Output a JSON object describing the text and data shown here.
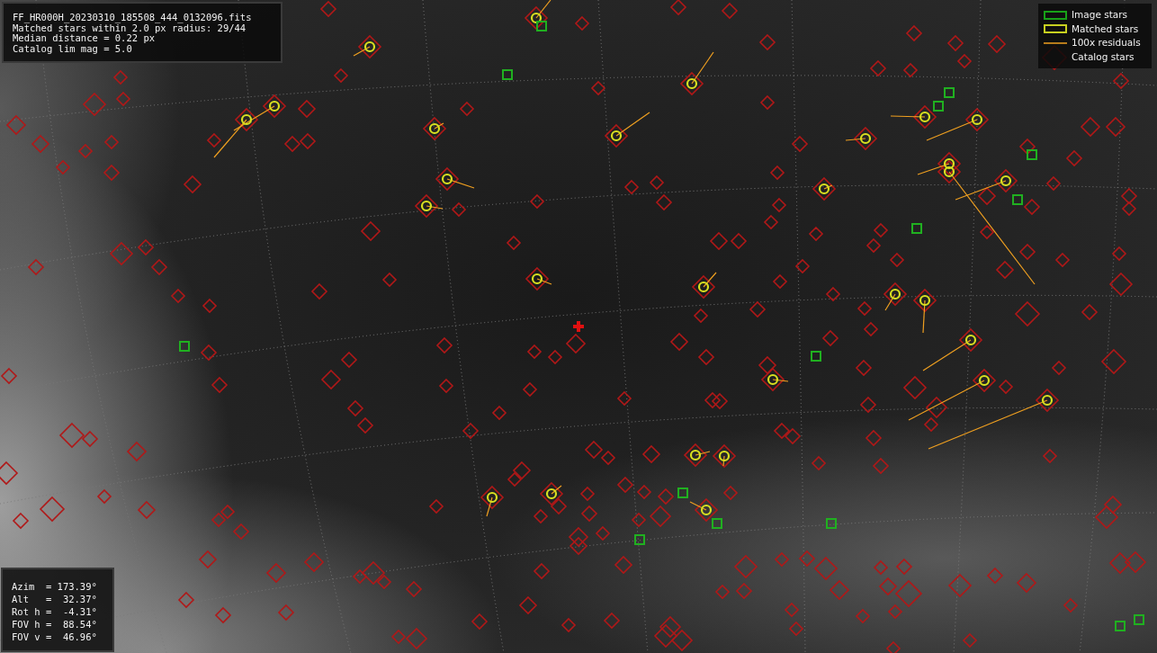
{
  "file_info": {
    "filename": "FF_HR000H_20230310_185508_444_0132096.fits",
    "lines": [
      "Matched stars within 2.0 px radius: 29/44",
      "Median distance = 0.22 px",
      "Catalog lim mag = 5.0"
    ]
  },
  "legend": [
    {
      "kind": "image",
      "label": "Image stars"
    },
    {
      "kind": "matched",
      "label": "Matched stars"
    },
    {
      "kind": "residual",
      "label": "100x residuals"
    },
    {
      "kind": "catalog",
      "label": "Catalog stars"
    }
  ],
  "pointing": [
    "Azim  = 173.39°",
    "Alt   =  32.37°",
    "Rot h =  -4.31°",
    "FOV h =  88.54°",
    "FOV v =  46.96°"
  ]
}
